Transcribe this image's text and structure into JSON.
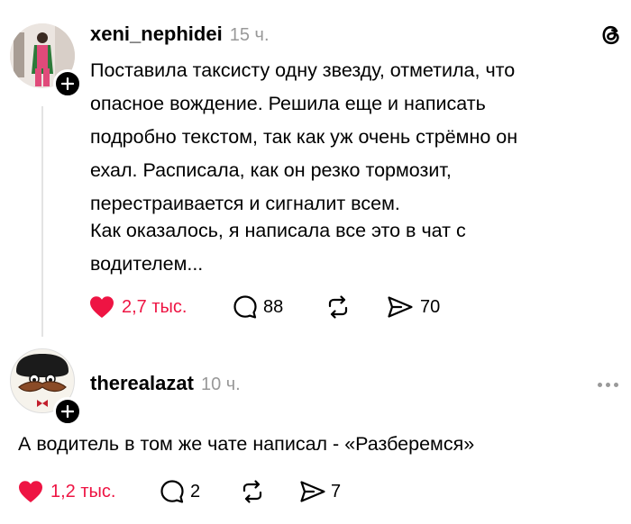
{
  "post": {
    "author": "xeni_nephidei",
    "time": "15 ч.",
    "paragraphs": [
      "Поставила таксисту одну звезду, отметила, что",
      "опасное вождение. Решила еще и написать",
      "подробно текстом, так как уж очень стрёмно он",
      "ехал. Расписала, как он резко тормозит,",
      "перестраивается и сигналит всем."
    ],
    "paragraph2": [
      "Как оказалось, я написала все это в чат с",
      "водителем..."
    ],
    "likes": "2,7 тыс.",
    "comments": "88",
    "shares": "70"
  },
  "reply": {
    "author": "therealazat",
    "time": "10 ч.",
    "text": "А водитель в том же чате написал - «Разберемся»",
    "likes": "1,2 тыс.",
    "comments": "2",
    "shares": "7"
  },
  "colors": {
    "like": "#ee1443",
    "muted": "#999999",
    "thread_line": "#e3e3e3"
  },
  "icons": [
    "threads-logo-icon",
    "heart-icon",
    "comment-icon",
    "repost-icon",
    "share-icon",
    "plus-icon",
    "more-icon"
  ]
}
